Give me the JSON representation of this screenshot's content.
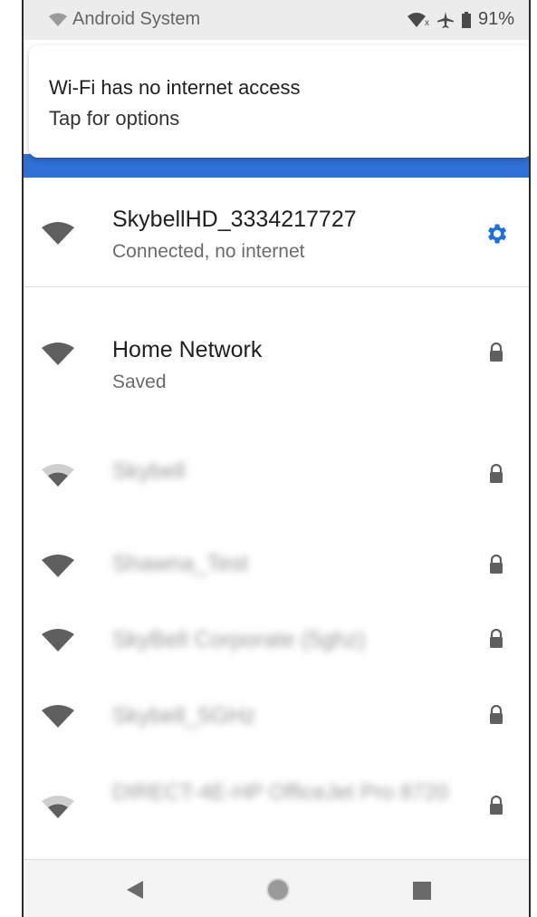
{
  "status_bar": {
    "source_app": "Android System",
    "battery": "91%"
  },
  "notification": {
    "title": "Wi-Fi has no internet access",
    "subtitle": "Tap for options"
  },
  "connected_network": {
    "name": "SkybellHD_3334217727",
    "status": "Connected, no internet"
  },
  "networks": [
    {
      "name": "Home Network",
      "status": "Saved"
    },
    {
      "name": "Skybell",
      "status": ""
    },
    {
      "name": "Shawna_Test",
      "status": ""
    },
    {
      "name": "SkyBell Corporate (5ghz)",
      "status": ""
    },
    {
      "name": "Skybell_5GHz",
      "status": ""
    },
    {
      "name": "DIRECT-4E-HP OfficeJet Pro 8720",
      "status": ""
    }
  ],
  "colors": {
    "accent": "#2f6fd6",
    "gear": "#1e6fd9",
    "wifi_icon": "#5f5f5f"
  }
}
